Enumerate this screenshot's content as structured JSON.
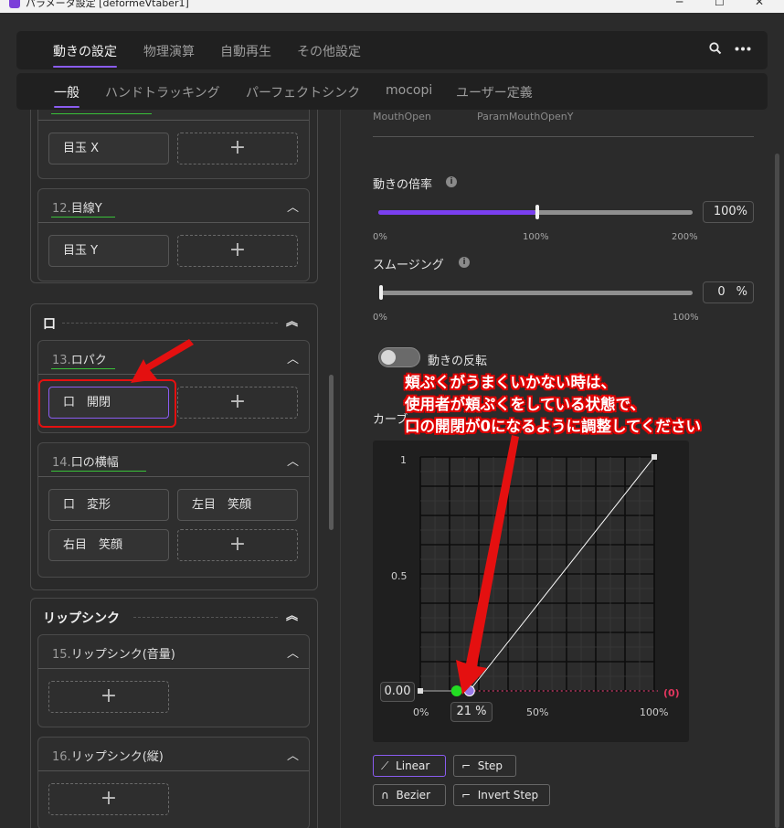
{
  "window": {
    "title": "パラメータ設定 [deformeVtaber1]",
    "minimize": "─",
    "maximize": "☐",
    "close": "✕"
  },
  "tabs_main": [
    {
      "label": "動きの設定",
      "active": true
    },
    {
      "label": "物理演算"
    },
    {
      "label": "自動再生"
    },
    {
      "label": "その他設定"
    }
  ],
  "tabs_sub": [
    {
      "label": "一般",
      "active": true
    },
    {
      "label": "ハンドトラッキング"
    },
    {
      "label": "パーフェクトシンク"
    },
    {
      "label": "mocopi"
    },
    {
      "label": "ユーザー定義"
    }
  ],
  "header_icons": {
    "search": "search-icon",
    "more": "more-icon"
  },
  "left": {
    "item11": {
      "button": "目玉 X",
      "add": "+"
    },
    "item12": {
      "num": "12.",
      "name": "目線Y",
      "button": "目玉 Y",
      "add": "+"
    },
    "section_mouth": {
      "title": "口"
    },
    "item13": {
      "num": "13.",
      "name": "ロパク",
      "button": "口　開閉",
      "add": "+"
    },
    "item14": {
      "num": "14.",
      "name": "口の横幅",
      "buttons": [
        "口　変形",
        "左目　笑顔",
        "右目　笑顔"
      ],
      "add": "+"
    },
    "section_lip": {
      "title": "リップシンク"
    },
    "item15": {
      "num": "15.",
      "name": "リップシンク(音量)",
      "add": "+"
    },
    "item16": {
      "num": "16.",
      "name": "リップシンク(縦)",
      "add": "+"
    }
  },
  "right": {
    "top_labels": [
      "MouthOpen",
      "ParamMouthOpenY"
    ],
    "multiplier": {
      "label": "動きの倍率",
      "value": "100",
      "unit": "%",
      "level": 0.5,
      "ticks": [
        "0%",
        "100%",
        "200%"
      ]
    },
    "smoothing": {
      "label": "スムージング",
      "value": "0",
      "unit": "%",
      "level": 0.0,
      "ticks": [
        "0%",
        "100%"
      ]
    },
    "invert": {
      "label": "動きの反転",
      "on": false
    },
    "curve_label": "カーブ",
    "graph": {
      "y_ticks": [
        "1",
        "0.5"
      ],
      "x_ticks": [
        "0%",
        "50%",
        "100%"
      ],
      "min_value": "0.00",
      "threshold_value": "21",
      "threshold_unit": "%",
      "zero_marker": "(0)",
      "threshold_fraction": 0.21
    },
    "modes": [
      "Linear",
      "Step",
      "Bezier",
      "Invert Step"
    ],
    "active_mode": "Linear"
  },
  "annotation": {
    "lines": [
      "頬ぷくがうまくいかない時は、",
      "使用者が頬ぷくをしている状態で、",
      "口の開閉が0になるように調整してください"
    ]
  },
  "colors": {
    "accent": "#8a5cf0",
    "highlight": "#e41010",
    "green": "#22dd22"
  }
}
